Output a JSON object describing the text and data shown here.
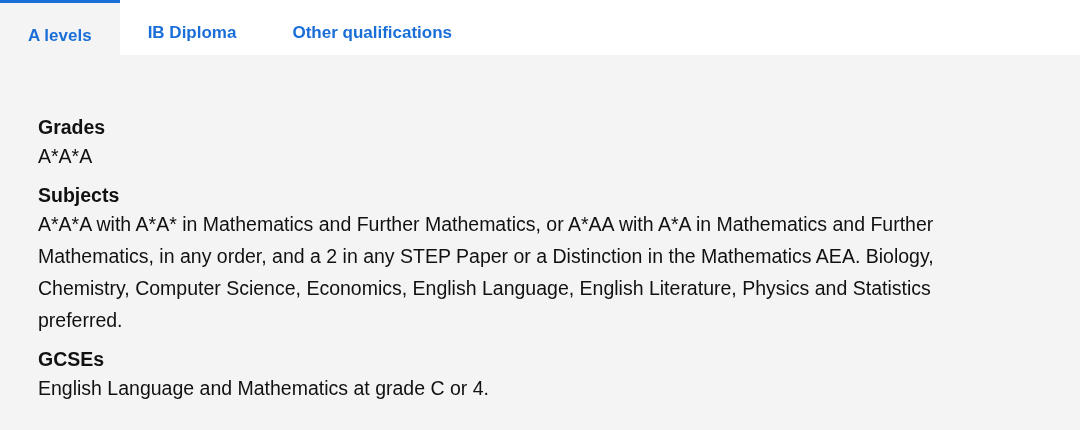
{
  "tabs": [
    {
      "label": "A levels",
      "selected": true
    },
    {
      "label": "IB Diploma",
      "selected": false
    },
    {
      "label": "Other qualifications",
      "selected": false
    }
  ],
  "sections": [
    {
      "heading": "Grades",
      "text": "A*A*A"
    },
    {
      "heading": "Subjects",
      "text": "A*A*A with A*A* in Mathematics and Further Mathematics, or A*AA with A*A in Mathematics and Further Mathematics, in any order, and a 2 in any STEP Paper or a Distinction in the Mathematics AEA. Biology, Chemistry, Computer Science, Economics, English Language, English Literature, Physics and Statistics preferred."
    },
    {
      "heading": "GCSEs",
      "text": "English Language and Mathematics at grade C or 4."
    }
  ]
}
